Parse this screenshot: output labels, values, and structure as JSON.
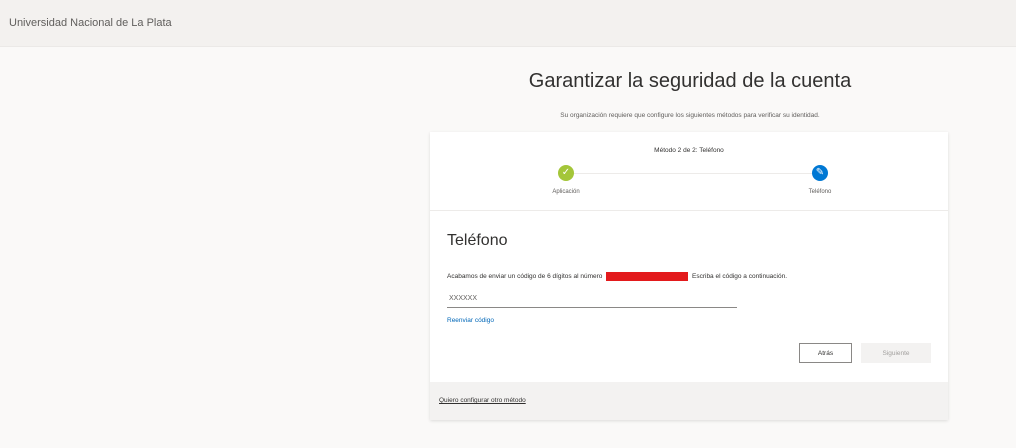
{
  "header": {
    "org_name": "Universidad Nacional de La Plata"
  },
  "page": {
    "title": "Garantizar la seguridad de la cuenta",
    "subtitle": "Su organización requiere que configure los siguientes métodos para verificar su identidad."
  },
  "steps": {
    "title": "Método 2 de 2: Teléfono",
    "items": [
      {
        "label": "Aplicación",
        "status": "done",
        "icon": "check-icon"
      },
      {
        "label": "Teléfono",
        "status": "current",
        "icon": "pencil-icon"
      }
    ]
  },
  "form": {
    "section_title": "Teléfono",
    "instruction_prefix": "Acabamos de enviar un código de 6 dígitos al número",
    "instruction_suffix": "Escriba el código a continuación.",
    "code_placeholder": "XXXXXX",
    "resend_link": "Reenviar código",
    "back_button": "Atrás",
    "next_button": "Siguiente"
  },
  "footer": {
    "other_method_link": "Quiero configurar otro método"
  },
  "colors": {
    "done": "#a4c639",
    "current": "#0078d4",
    "link": "#0067b8",
    "redaction": "#e31a1c"
  }
}
